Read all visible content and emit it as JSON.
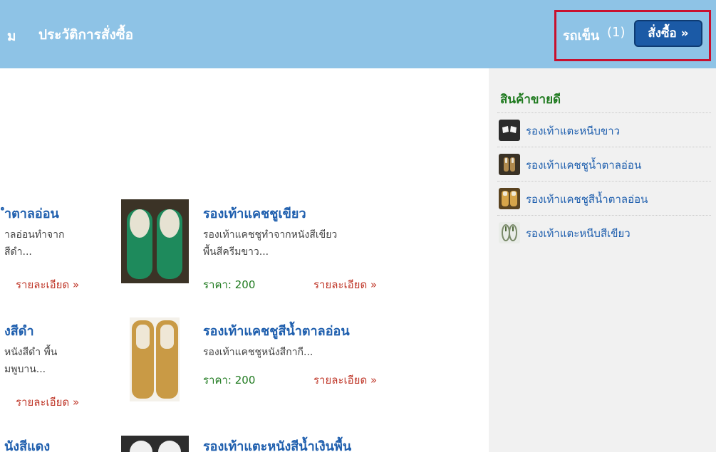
{
  "nav": {
    "partial_label": "ม",
    "order_history": "ประวัติการสั่งซื้อ"
  },
  "cart": {
    "label": "รถเข็น",
    "count": "(1)",
    "order_button": "สั่งซื้อ »"
  },
  "bestsellers": {
    "title": "สินค้าขายดี",
    "items": [
      {
        "label": "รองเท้าแตะหนีบขาว",
        "icon": "white-flipflop-thumb"
      },
      {
        "label": "รองเท้าแคชชูน้ำตาลอ่อน",
        "icon": "brown-clog-thumb"
      },
      {
        "label": "รองเท้าแคชชูสีน้ำตาลอ่อน",
        "icon": "tan-clog-thumb"
      },
      {
        "label": "รองเท้าแตะหนีบสีเขียว",
        "icon": "green-flipflop-thumb"
      }
    ]
  },
  "products_left": [
    {
      "title": "ำตาลอ่อน",
      "desc1": "าลอ่อนทำจาก",
      "desc2": "สีดำ...",
      "detail": "รายละเอียด »"
    },
    {
      "title": "งสีดำ",
      "desc1": "หนังสีดำ พื้น",
      "desc2": "มพูบาน...",
      "detail": "รายละเอียด »"
    },
    {
      "title": "นังสีแดง"
    }
  ],
  "products_right": [
    {
      "title": "รองเท้าแคชชูเขียว",
      "desc1": "รองเท้าแคชชูทำจากหนังสีเขียว",
      "desc2": "พื้นสีครีมขาว...",
      "price": "ราคา: 200",
      "detail": "รายละเอียด »"
    },
    {
      "title": "รองเท้าแคชชูสีน้ำตาลอ่อน",
      "desc1": "รองเท้าแคชชูหนังสีกากี...",
      "price": "ราคา: 200",
      "detail": "รายละเอียด »"
    },
    {
      "title": "รองเท้าแตะหนังสีน้ำเงินพื้น"
    }
  ],
  "colors": {
    "header_bg": "#8ec3e6",
    "sidebar_bg": "#f1f1f1",
    "link_blue": "#1f5fae",
    "price_green": "#1f7a1f",
    "detail_red": "#c0392b",
    "highlight_border": "#c8102e",
    "button_blue": "#1b5aa6"
  }
}
